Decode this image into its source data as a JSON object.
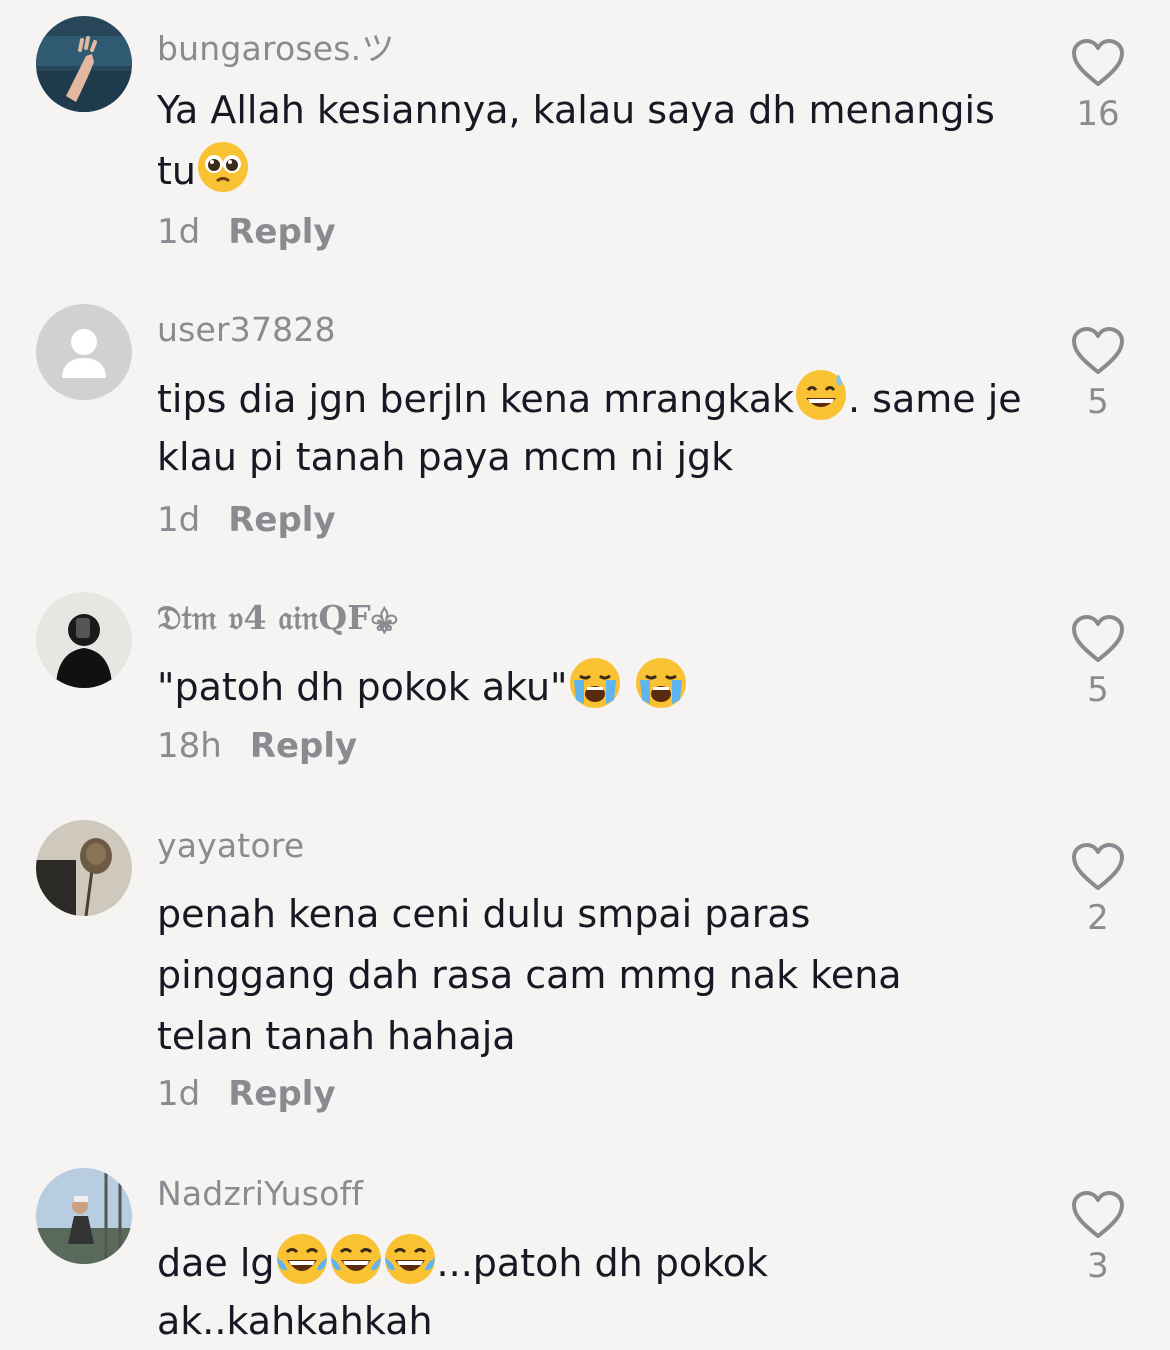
{
  "comments": [
    {
      "username": "bungaroses.ツ",
      "text_parts": [
        "Ya Allah kesiannya, kalau saya dh menangis tu"
      ],
      "emoji_after": "pleading-face-emoji",
      "time": "1d",
      "reply_label": "Reply",
      "likes": "16"
    },
    {
      "username": "user37828",
      "text_before": "tips dia jgn berjln kena mrangkak",
      "emoji_mid": "grinning-sweat-emoji",
      "text_after": ". same je klau pi tanah paya mcm ni jgk",
      "time": "1d",
      "reply_label": "Reply",
      "likes": "5"
    },
    {
      "username": "𝔇𝔱𝔪 𝔳4 𝔞𝔦𝔫QF⚜",
      "text": "\"patoh dh pokok aku\"",
      "emojis": [
        "loudly-crying-emoji",
        "loudly-crying-emoji"
      ],
      "time": "18h",
      "reply_label": "Reply",
      "likes": "5"
    },
    {
      "username": "yayatore",
      "text": "penah kena ceni dulu smpai paras pinggang dah rasa cam mmg nak kena telan tanah hahaja",
      "time": "1d",
      "reply_label": "Reply",
      "likes": "2"
    },
    {
      "username": "NadzriYusoff",
      "text_before": "dae lg",
      "emojis": [
        "tears-of-joy-emoji",
        "tears-of-joy-emoji",
        "tears-of-joy-emoji"
      ],
      "text_after": "...patoh dh pokok ak..kahkahkah",
      "likes": "3"
    }
  ],
  "colors": {
    "background": "#f5f4f3",
    "text": "#161823",
    "muted": "#8a8b91"
  },
  "icons": {
    "like": "heart-outline-icon",
    "default_avatar": "person-icon"
  }
}
